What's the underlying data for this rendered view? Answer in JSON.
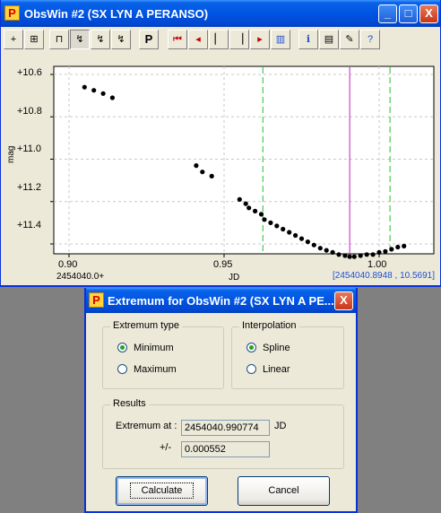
{
  "window": {
    "title": "ObsWin #2 (SX LYN A PERANSO)",
    "icon": "P",
    "controls": [
      "_",
      "□",
      "X"
    ]
  },
  "toolbar": {
    "p_label": "P",
    "buttons": [
      "zoom-in",
      "zoom-fit",
      "bracket",
      "lightcurve-a",
      "lightcurve-b",
      "lightcurve-c",
      "p",
      "first",
      "prev",
      "step-back",
      "step-fwd",
      "next",
      "last",
      "book",
      "info",
      "table",
      "edit",
      "help"
    ]
  },
  "chart_data": {
    "type": "scatter",
    "ylabel": "mag",
    "xlabel": "JD",
    "x_offset_label": "2454040.0+",
    "xlim": [
      0.9,
      1.0
    ],
    "xlim_display": [
      0.897,
      1.015
    ],
    "x_ticks": [
      "0.90",
      "0.95",
      "1.00"
    ],
    "y_ticks": [
      "+10.6",
      "+10.8",
      "+11.0",
      "+11.2",
      "+11.4"
    ],
    "ylim": [
      10.6,
      11.4
    ],
    "y_inverted": true,
    "grid": true,
    "cursor_readout": "[2454040.8948 , 10.5691]",
    "green_lines_x": [
      0.9625,
      1.0035
    ],
    "magenta_line_x": 0.9905,
    "points": [
      [
        0.905,
        10.66
      ],
      [
        0.908,
        10.675
      ],
      [
        0.911,
        10.69
      ],
      [
        0.914,
        10.71
      ],
      [
        0.941,
        11.03
      ],
      [
        0.943,
        11.06
      ],
      [
        0.946,
        11.08
      ],
      [
        0.955,
        11.19
      ],
      [
        0.957,
        11.21
      ],
      [
        0.958,
        11.23
      ],
      [
        0.96,
        11.245
      ],
      [
        0.962,
        11.26
      ],
      [
        0.963,
        11.285
      ],
      [
        0.965,
        11.3
      ],
      [
        0.967,
        11.315
      ],
      [
        0.969,
        11.33
      ],
      [
        0.971,
        11.345
      ],
      [
        0.973,
        11.36
      ],
      [
        0.975,
        11.375
      ],
      [
        0.977,
        11.39
      ],
      [
        0.979,
        11.405
      ],
      [
        0.981,
        11.42
      ],
      [
        0.983,
        11.43
      ],
      [
        0.985,
        11.44
      ],
      [
        0.987,
        11.45
      ],
      [
        0.989,
        11.455
      ],
      [
        0.9905,
        11.46
      ],
      [
        0.992,
        11.46
      ],
      [
        0.994,
        11.455
      ],
      [
        0.996,
        11.45
      ],
      [
        0.998,
        11.45
      ],
      [
        1.0,
        11.44
      ],
      [
        1.002,
        11.435
      ],
      [
        1.004,
        11.425
      ],
      [
        1.006,
        11.415
      ],
      [
        1.008,
        11.41
      ]
    ]
  },
  "dialog": {
    "title": "Extremum for ObsWin #2 (SX LYN A PE...",
    "extremum_type": {
      "label": "Extremum type",
      "options": [
        "Minimum",
        "Maximum"
      ],
      "selected": "Minimum"
    },
    "interpolation": {
      "label": "Interpolation",
      "options": [
        "Spline",
        "Linear"
      ],
      "selected": "Spline"
    },
    "results": {
      "label": "Results",
      "extremum_label": "Extremum at :",
      "extremum_value": "2454040.990774",
      "extremum_unit": "JD",
      "error_label": "+/-",
      "error_value": "0.000552"
    },
    "calculate_label": "Calculate",
    "cancel_label": "Cancel"
  }
}
